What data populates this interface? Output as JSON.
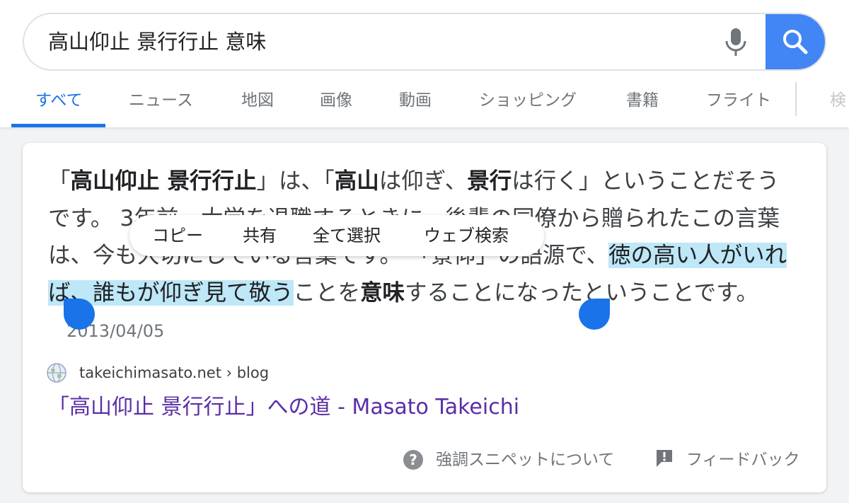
{
  "search": {
    "query": "高山仰止 景行行止 意味",
    "mic_icon": "mic-icon",
    "search_icon": "search-icon",
    "accent_color": "#4285f4"
  },
  "tabs": [
    {
      "label": "すべて",
      "active": true
    },
    {
      "label": "ニュース"
    },
    {
      "label": "地図"
    },
    {
      "label": "画像"
    },
    {
      "label": "動画"
    },
    {
      "label": "ショッピング"
    },
    {
      "label": "書籍"
    },
    {
      "label": "フライト"
    },
    {
      "label": "検"
    }
  ],
  "snippet": {
    "parts": [
      {
        "t": "「"
      },
      {
        "t": "高山仰止 景行行止",
        "b": true
      },
      {
        "t": "」は、「"
      },
      {
        "t": "高山",
        "b": true
      },
      {
        "t": "は仰ぎ、"
      },
      {
        "t": "景行",
        "b": true
      },
      {
        "t": "は行く」ということだそうです。 3年前、大学を退職するときに、後輩の同僚から贈られたこの言葉は、今も大切にしている言葉です。 「景仰」の語源で、"
      },
      {
        "t": "徳の高い人がいれば、誰もが仰ぎ見て敬う",
        "sel": true
      },
      {
        "t": "ことを"
      },
      {
        "t": "意味",
        "b": true
      },
      {
        "t": "することになったということです。"
      }
    ],
    "date": "2013/04/05"
  },
  "context_menu": {
    "items": [
      "コピー",
      "共有",
      "全て選択",
      "ウェブ検索"
    ]
  },
  "result": {
    "source": "takeichimasato.net › blog",
    "title": "「高山仰止 景行行止」への道 - Masato Takeichi",
    "link_color": "#5a2ea6"
  },
  "footer": {
    "about_label": "強調スニペットについて",
    "feedback_label": "フィードバック"
  }
}
